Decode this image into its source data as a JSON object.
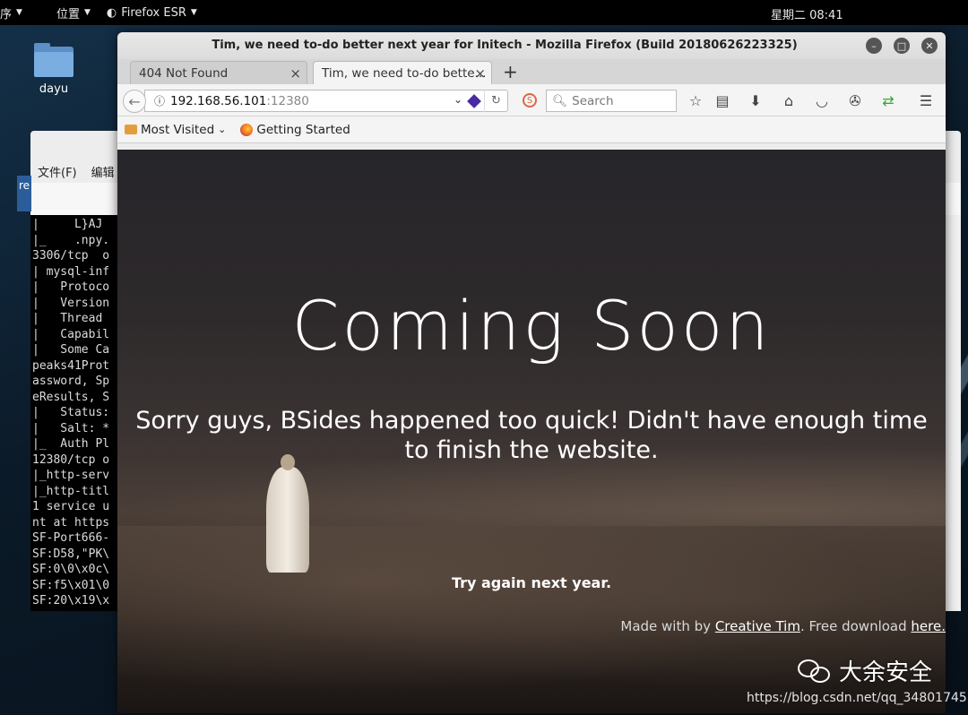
{
  "topbar": {
    "app_menu": "序",
    "places": "位置",
    "browser": "Firefox ESR",
    "clock": "星期二 08:41"
  },
  "desktop": {
    "icon_label": "dayu"
  },
  "terminal": {
    "menu": [
      "文件(F)",
      "编辑"
    ],
    "lines": [
      "|     L}AJ",
      "|_    .npy.",
      "3306/tcp  o",
      "| mysql-inf",
      "|   Protoco",
      "|   Version",
      "|   Thread",
      "|   Capabil",
      "|   Some Ca",
      "peaks41Prot",
      "assword, Sp",
      "eResults, S",
      "|   Status:",
      "|   Salt: *",
      "|_  Auth Pl",
      "12380/tcp o",
      "|_http-serv",
      "|_http-titl",
      "1 service u",
      "nt at https",
      "SF-Port666-",
      "SF:D58,\"PK\\",
      "SF:0\\0\\x0c\\",
      "SF:f5\\x01\\0",
      "SF:20\\x19\\x"
    ],
    "side_tab": "re"
  },
  "firefox": {
    "title": "Tim, we need to-do better next year for Initech - Mozilla Firefox (Build 20180626223325)",
    "tabs": [
      {
        "label": "404 Not Found",
        "active": false
      },
      {
        "label": "Tim, we need to-do bette...",
        "active": true
      }
    ],
    "url_host": "192.168.56.101",
    "url_port": ":12380",
    "search_placeholder": "Search",
    "bookmarks": [
      "Most Visited",
      "Getting Started"
    ]
  },
  "page": {
    "heading": "Coming Soon",
    "subheading": "Sorry guys, BSides happened too quick! Didn't have enough time to finish the website.",
    "try_again": "Try again next year.",
    "made_with_prefix": "Made with by",
    "made_with_link": "Creative Tim",
    "free_download": ". Free download",
    "here_link": "here."
  },
  "watermark": {
    "brand": "大余安全",
    "url": "https://blog.csdn.net/qq_34801745"
  }
}
